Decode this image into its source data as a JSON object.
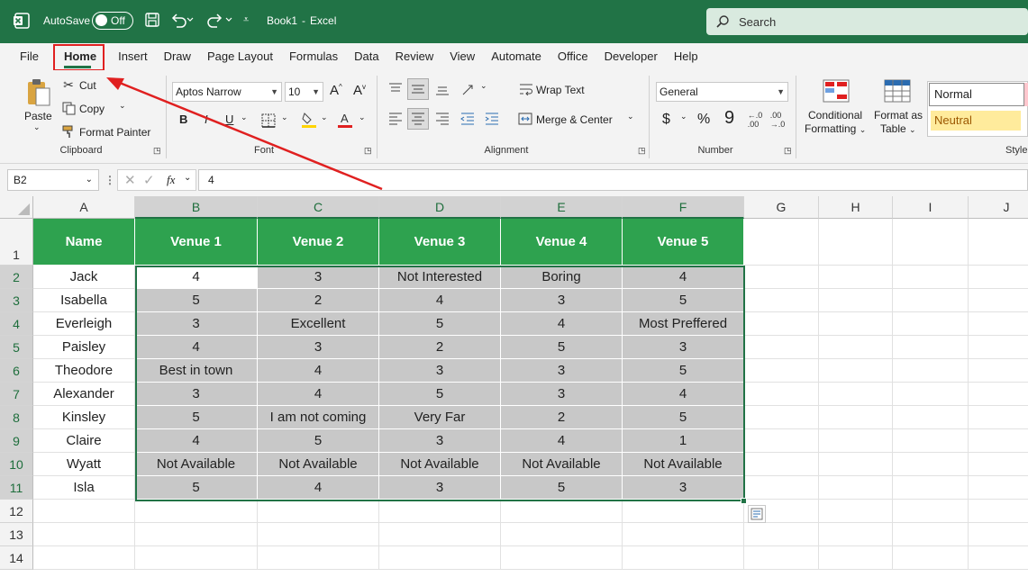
{
  "title": {
    "autosave": "AutoSave",
    "toggle": "Off",
    "filename": "Book1",
    "sep": "-",
    "app": "Excel",
    "search": "Search"
  },
  "menu": [
    "File",
    "Home",
    "Insert",
    "Draw",
    "Page Layout",
    "Formulas",
    "Data",
    "Review",
    "View",
    "Automate",
    "Office",
    "Developer",
    "Help"
  ],
  "ribbon": {
    "paste": "Paste",
    "cut": "Cut",
    "copy": "Copy",
    "format_painter": "Format Painter",
    "clipboard": "Clipboard",
    "font_name": "Aptos Narrow",
    "font_size": "10",
    "font": "Font",
    "bold": "B",
    "italic": "I",
    "underline": "U",
    "wrap_text": "Wrap Text",
    "merge_center": "Merge & Center",
    "alignment": "Alignment",
    "number_format": "General",
    "currency": "$",
    "percent": "%",
    "comma": "9",
    "number": "Number",
    "cond_fmt_1": "Conditional",
    "cond_fmt_2": "Formatting",
    "fmt_table_1": "Format as",
    "fmt_table_2": "Table",
    "style_normal": "Normal",
    "style_neutral": "Neutral",
    "styles": "Style"
  },
  "formula": {
    "namebox": "B2",
    "fx": "fx",
    "value": "4"
  },
  "columns": [
    "A",
    "B",
    "C",
    "D",
    "E",
    "F",
    "G",
    "H",
    "I",
    "J"
  ],
  "rows": [
    "1",
    "2",
    "3",
    "4",
    "5",
    "6",
    "7",
    "8",
    "9",
    "10",
    "11",
    "12",
    "13",
    "14"
  ],
  "header": [
    "Name",
    "Venue 1",
    "Venue 2",
    "Venue 3",
    "Venue 4",
    "Venue 5"
  ],
  "table": [
    [
      "Jack",
      "4",
      "3",
      "Not Interested",
      "Boring",
      "4"
    ],
    [
      "Isabella",
      "5",
      "2",
      "4",
      "3",
      "5"
    ],
    [
      "Everleigh",
      "3",
      "Excellent",
      "5",
      "4",
      "Most Preffered"
    ],
    [
      "Paisley",
      "4",
      "3",
      "2",
      "5",
      "3"
    ],
    [
      "Theodore",
      "Best in town",
      "4",
      "3",
      "3",
      "5"
    ],
    [
      "Alexander",
      "3",
      "4",
      "5",
      "3",
      "4"
    ],
    [
      "Kinsley",
      "5",
      "I am not coming",
      "Very Far",
      "2",
      "5"
    ],
    [
      "Claire",
      "4",
      "5",
      "3",
      "4",
      "1"
    ],
    [
      "Wyatt",
      "Not Available",
      "Not Available",
      "Not Available",
      "Not Available",
      "Not Available"
    ],
    [
      "Isla",
      "5",
      "4",
      "3",
      "5",
      "3"
    ]
  ],
  "colors": {
    "excel_green": "#217346",
    "header_green": "#2ea24f",
    "highlight_red": "#e02020",
    "selection_gray": "#c8c8c8"
  }
}
